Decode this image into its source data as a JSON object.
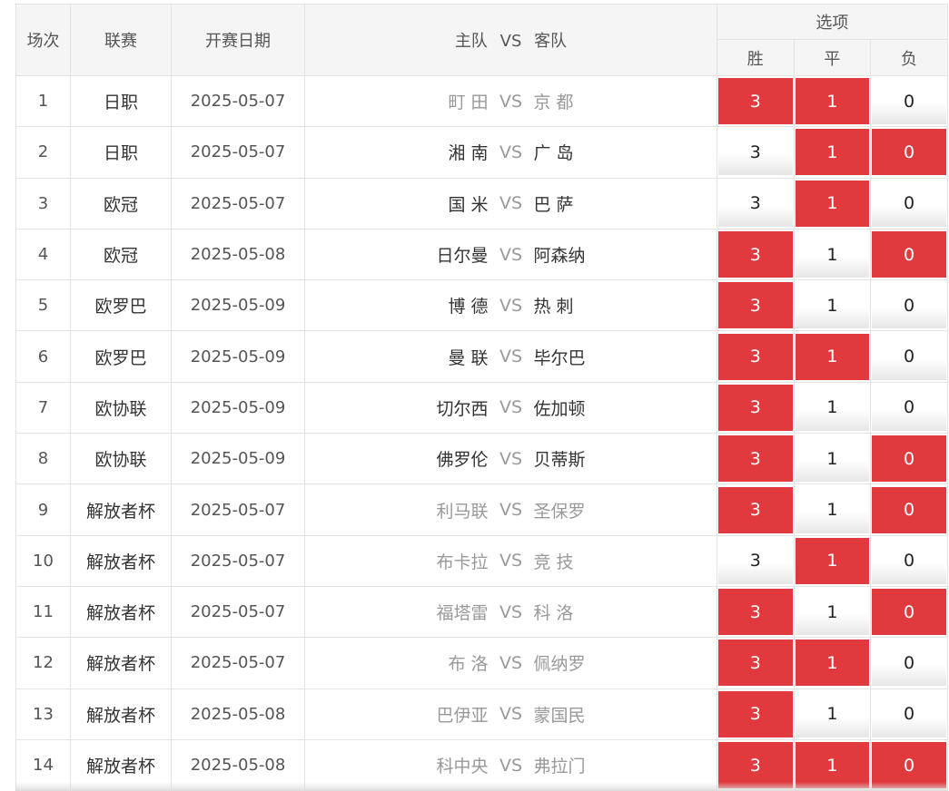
{
  "header": {
    "no": "场次",
    "league": "联赛",
    "date": "开赛日期",
    "home": "主队",
    "vs": "VS",
    "away": "客队",
    "options": "选项",
    "win": "胜",
    "draw": "平",
    "lose": "负"
  },
  "colors": {
    "selected": "#e03a3e",
    "unselected": "#ffffff"
  },
  "matches": [
    {
      "no": "1",
      "league": "日职",
      "date": "2025-05-07",
      "home": "町 田",
      "away": "京 都",
      "muted": true,
      "options": {
        "win": "3",
        "draw": "1",
        "lose": "0"
      },
      "selected": {
        "win": true,
        "draw": true,
        "lose": false
      }
    },
    {
      "no": "2",
      "league": "日职",
      "date": "2025-05-07",
      "home": "湘 南",
      "away": "广 岛",
      "muted": false,
      "options": {
        "win": "3",
        "draw": "1",
        "lose": "0"
      },
      "selected": {
        "win": false,
        "draw": true,
        "lose": true
      }
    },
    {
      "no": "3",
      "league": "欧冠",
      "date": "2025-05-07",
      "home": "国 米",
      "away": "巴 萨",
      "muted": false,
      "options": {
        "win": "3",
        "draw": "1",
        "lose": "0"
      },
      "selected": {
        "win": false,
        "draw": true,
        "lose": false
      }
    },
    {
      "no": "4",
      "league": "欧冠",
      "date": "2025-05-08",
      "home": "日尔曼",
      "away": "阿森纳",
      "muted": false,
      "options": {
        "win": "3",
        "draw": "1",
        "lose": "0"
      },
      "selected": {
        "win": true,
        "draw": false,
        "lose": true
      }
    },
    {
      "no": "5",
      "league": "欧罗巴",
      "date": "2025-05-09",
      "home": "博 德",
      "away": "热 刺",
      "muted": false,
      "options": {
        "win": "3",
        "draw": "1",
        "lose": "0"
      },
      "selected": {
        "win": true,
        "draw": false,
        "lose": false
      }
    },
    {
      "no": "6",
      "league": "欧罗巴",
      "date": "2025-05-09",
      "home": "曼 联",
      "away": "毕尔巴",
      "muted": false,
      "options": {
        "win": "3",
        "draw": "1",
        "lose": "0"
      },
      "selected": {
        "win": true,
        "draw": true,
        "lose": false
      }
    },
    {
      "no": "7",
      "league": "欧协联",
      "date": "2025-05-09",
      "home": "切尔西",
      "away": "佐加顿",
      "muted": false,
      "options": {
        "win": "3",
        "draw": "1",
        "lose": "0"
      },
      "selected": {
        "win": true,
        "draw": false,
        "lose": false
      }
    },
    {
      "no": "8",
      "league": "欧协联",
      "date": "2025-05-09",
      "home": "佛罗伦",
      "away": "贝蒂斯",
      "muted": false,
      "options": {
        "win": "3",
        "draw": "1",
        "lose": "0"
      },
      "selected": {
        "win": true,
        "draw": false,
        "lose": true
      }
    },
    {
      "no": "9",
      "league": "解放者杯",
      "date": "2025-05-07",
      "home": "利马联",
      "away": "圣保罗",
      "muted": true,
      "options": {
        "win": "3",
        "draw": "1",
        "lose": "0"
      },
      "selected": {
        "win": true,
        "draw": false,
        "lose": true
      }
    },
    {
      "no": "10",
      "league": "解放者杯",
      "date": "2025-05-07",
      "home": "布卡拉",
      "away": "竞 技",
      "muted": true,
      "options": {
        "win": "3",
        "draw": "1",
        "lose": "0"
      },
      "selected": {
        "win": false,
        "draw": true,
        "lose": false
      }
    },
    {
      "no": "11",
      "league": "解放者杯",
      "date": "2025-05-07",
      "home": "福塔雷",
      "away": "科 洛",
      "muted": true,
      "options": {
        "win": "3",
        "draw": "1",
        "lose": "0"
      },
      "selected": {
        "win": true,
        "draw": false,
        "lose": true
      }
    },
    {
      "no": "12",
      "league": "解放者杯",
      "date": "2025-05-07",
      "home": "布 洛",
      "away": "佩纳罗",
      "muted": true,
      "options": {
        "win": "3",
        "draw": "1",
        "lose": "0"
      },
      "selected": {
        "win": true,
        "draw": true,
        "lose": false
      }
    },
    {
      "no": "13",
      "league": "解放者杯",
      "date": "2025-05-08",
      "home": "巴伊亚",
      "away": "蒙国民",
      "muted": true,
      "options": {
        "win": "3",
        "draw": "1",
        "lose": "0"
      },
      "selected": {
        "win": true,
        "draw": false,
        "lose": false
      }
    },
    {
      "no": "14",
      "league": "解放者杯",
      "date": "2025-05-08",
      "home": "科中央",
      "away": "弗拉门",
      "muted": true,
      "options": {
        "win": "3",
        "draw": "1",
        "lose": "0"
      },
      "selected": {
        "win": true,
        "draw": true,
        "lose": true
      }
    }
  ]
}
